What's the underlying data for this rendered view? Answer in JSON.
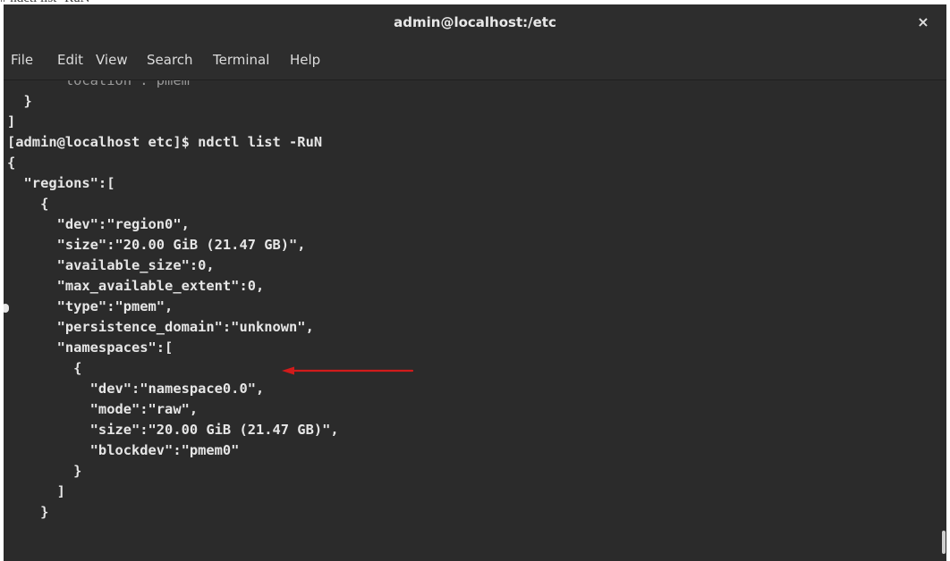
{
  "document_fragment": "# ndctl list -RuN",
  "window": {
    "title": "admin@localhost:/etc",
    "close_glyph": "×"
  },
  "menu": [
    "File",
    "Edit",
    "View",
    "Search",
    "Terminal",
    "Help"
  ],
  "terminal": {
    "partial_top_line": "      \"location\":\"pmem\"",
    "lines": [
      "  }",
      "]",
      "[admin@localhost etc]$ ndctl list -RuN",
      "{",
      "  \"regions\":[",
      "    {",
      "      \"dev\":\"region0\",",
      "      \"size\":\"20.00 GiB (21.47 GB)\",",
      "      \"available_size\":0,",
      "      \"max_available_extent\":0,",
      "      \"type\":\"pmem\",",
      "      \"persistence_domain\":\"unknown\",",
      "      \"namespaces\":[",
      "        {",
      "          \"dev\":\"namespace0.0\",",
      "          \"mode\":\"raw\",",
      "          \"size\":\"20.00 GiB (21.47 GB)\",",
      "          \"blockdev\":\"pmem0\"",
      "        }",
      "      ]",
      "    }"
    ]
  },
  "annotation": {
    "icon": "red-arrow-left",
    "color": "#d11b1b"
  },
  "colors": {
    "terminal_bg": "#2b2b2b",
    "chrome_bg": "#2d2d2d",
    "text": "#e6e6e6"
  }
}
